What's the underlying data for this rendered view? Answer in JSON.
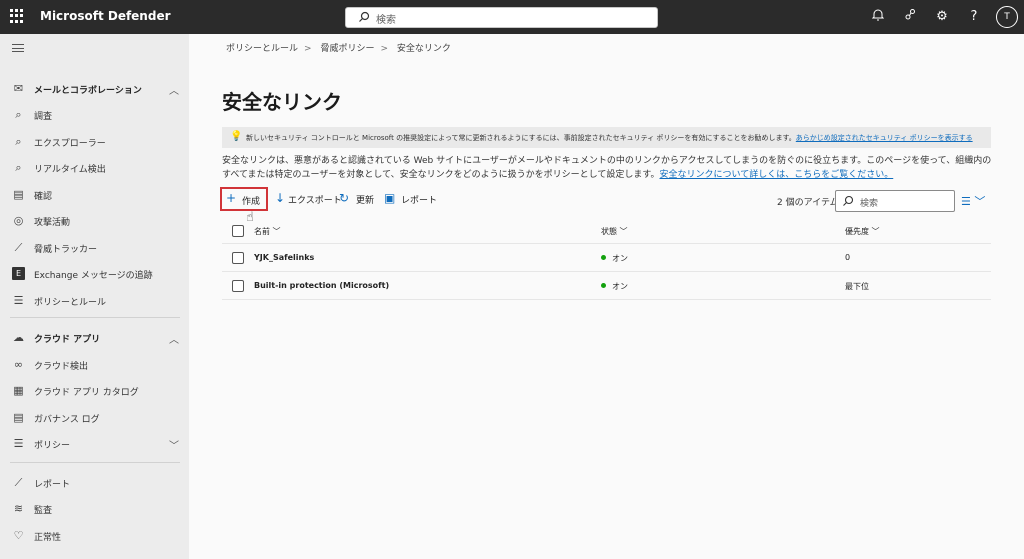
{
  "app": {
    "title": "Microsoft Defender"
  },
  "topbar": {
    "search_placeholder": "検索",
    "avatar_initial": "T"
  },
  "sidebar": {
    "sections": [
      {
        "label": "メールとコラボレーション",
        "icon": "mail-icon"
      },
      {
        "label": "調査",
        "icon": "investigation-icon"
      },
      {
        "label": "エクスプローラー",
        "icon": "explorer-icon"
      },
      {
        "label": "リアルタイム検出",
        "icon": "realtime-icon"
      },
      {
        "label": "確認",
        "icon": "review-icon"
      },
      {
        "label": "攻撃活動",
        "icon": "campaign-icon"
      },
      {
        "label": "脅威トラッカー",
        "icon": "tracker-icon"
      },
      {
        "label": "Exchange メッセージの追跡",
        "icon": "exchange-icon"
      },
      {
        "label": "ポリシーとルール",
        "icon": "policy-icon"
      },
      {
        "label": "クラウド アプリ",
        "icon": "cloud-icon"
      },
      {
        "label": "クラウド検出",
        "icon": "binoculars-icon"
      },
      {
        "label": "クラウド アプリ カタログ",
        "icon": "catalog-icon"
      },
      {
        "label": "ガバナンス ログ",
        "icon": "log-icon"
      },
      {
        "label": "ポリシー",
        "icon": "policy-icon"
      },
      {
        "label": "レポート",
        "icon": "report-icon"
      },
      {
        "label": "監査",
        "icon": "audit-icon"
      },
      {
        "label": "正常性",
        "icon": "health-icon"
      }
    ]
  },
  "breadcrumb": [
    "ポリシーとルール",
    "脅威ポリシー",
    "安全なリンク"
  ],
  "page": {
    "title": "安全なリンク",
    "banner_text": "新しいセキュリティ コントロールと Microsoft の推奨設定によって常に更新されるようにするには、事前設定されたセキュリティ ポリシーを有効にすることをお勧めします。",
    "banner_link": "あらかじめ設定されたセキュリティ ポリシーを表示する",
    "description": "安全なリンクは、悪意があると認識されている Web サイトにユーザーがメールやドキュメントの中のリンクからアクセスしてしまうのを防ぐのに役立ちます。このページを使って、組織内のすべてまたは特定のユーザーを対象として、安全なリンクをどのように扱うかをポリシーとして設定します。",
    "description_link": "安全なリンクについて詳しくは、こちらをご覧ください。"
  },
  "toolbar": {
    "create": "作成",
    "export": "エクスポート",
    "refresh": "更新",
    "report": "レポート",
    "item_count": "2 個のアイテム",
    "search_placeholder": "検索"
  },
  "table": {
    "headers": {
      "name": "名前",
      "state": "状態",
      "priority": "優先度"
    },
    "rows": [
      {
        "name": "YJK_Safelinks",
        "state": "オン",
        "priority": "0"
      },
      {
        "name": "Built-in protection (Microsoft)",
        "state": "オン",
        "priority": "最下位"
      }
    ]
  },
  "colors": {
    "accent": "#0f6cbd",
    "highlight_box": "#d13438",
    "status_on": "#13a10e",
    "topbar": "#2b2b2b"
  }
}
